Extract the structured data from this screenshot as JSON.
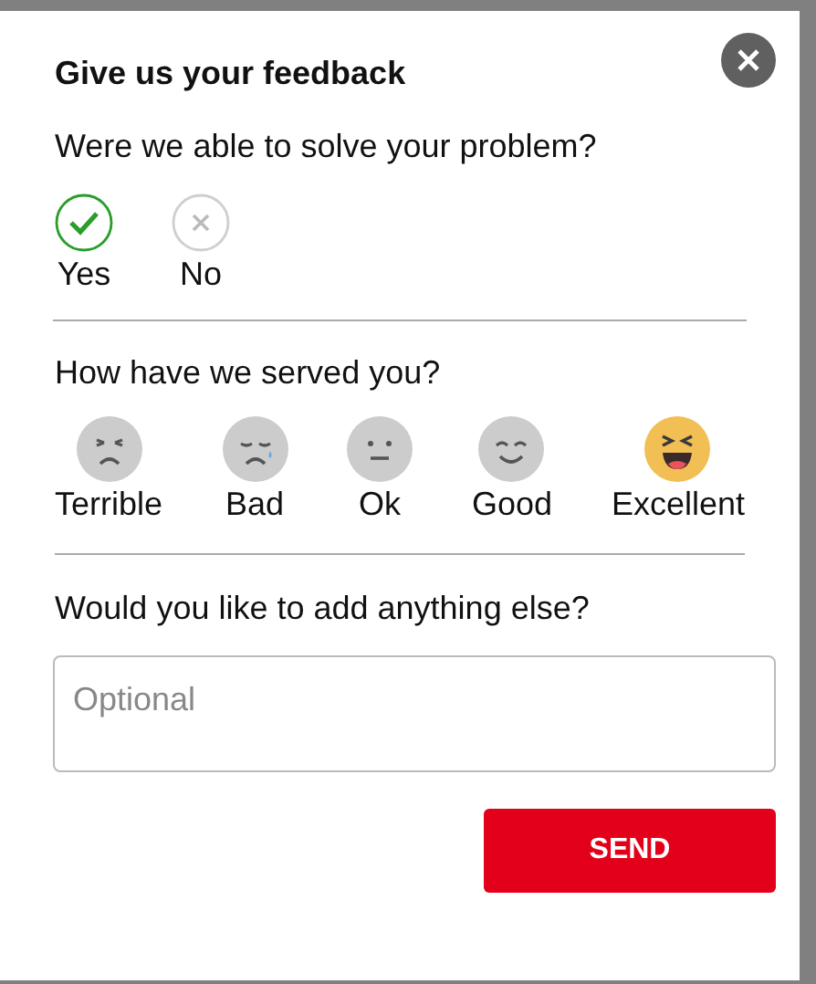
{
  "dialog": {
    "title": "Give us your feedback"
  },
  "solved": {
    "question": "Were we able to solve your problem?",
    "options": [
      {
        "kind": "yes",
        "label": "Yes",
        "selected": true
      },
      {
        "kind": "no",
        "label": "No",
        "selected": false
      }
    ]
  },
  "rating": {
    "question": "How have we served you?",
    "options": [
      {
        "kind": "terrible",
        "label": "Terrible",
        "selected": false
      },
      {
        "kind": "bad",
        "label": "Bad",
        "selected": false
      },
      {
        "kind": "ok",
        "label": "Ok",
        "selected": false
      },
      {
        "kind": "good",
        "label": "Good",
        "selected": false
      },
      {
        "kind": "excellent",
        "label": "Excellent",
        "selected": true
      }
    ]
  },
  "comment": {
    "question": "Would you like to add anything else?",
    "placeholder": "Optional"
  },
  "send_button": "SEND"
}
